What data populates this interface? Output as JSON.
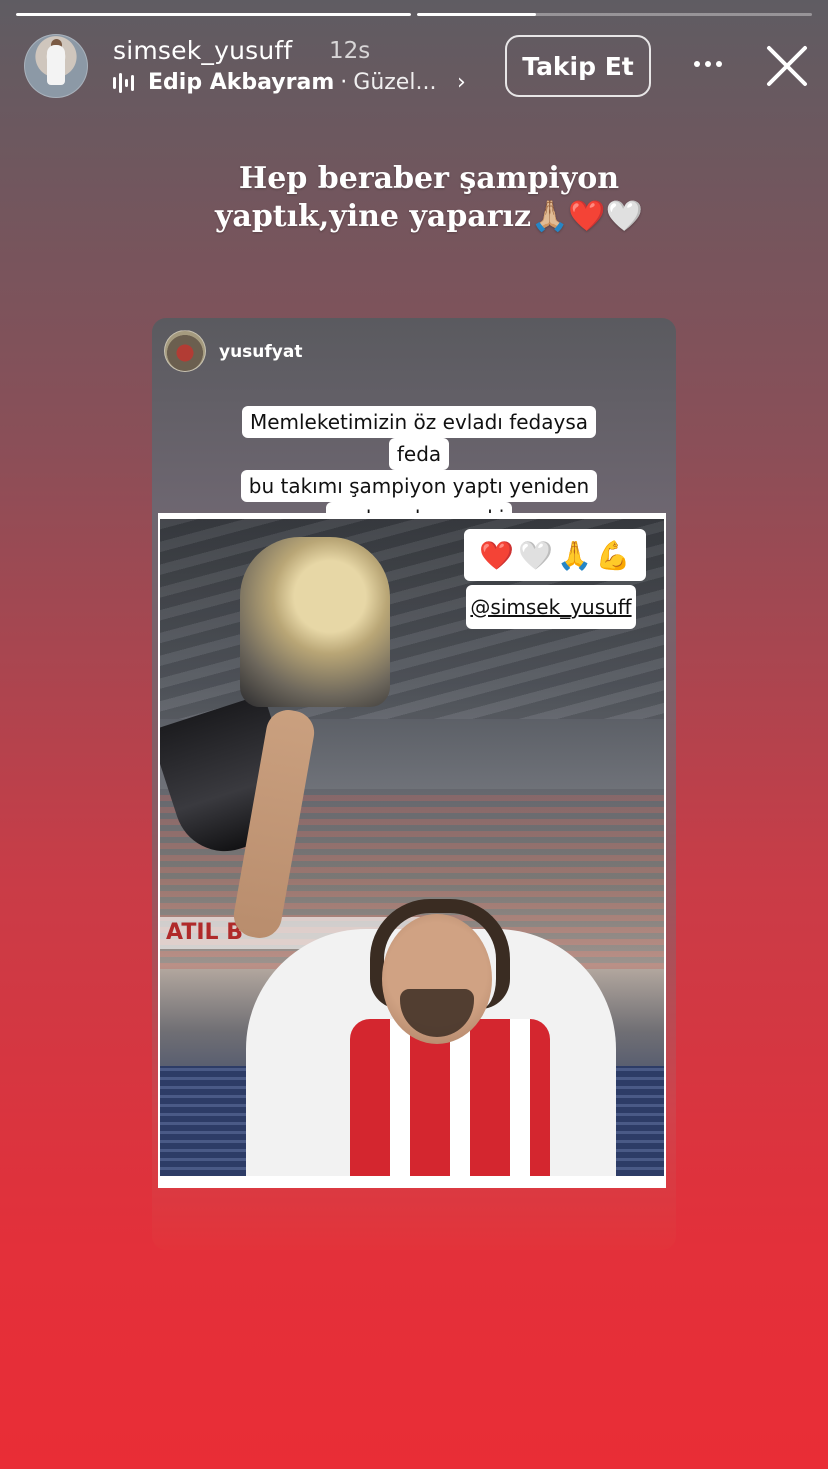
{
  "story": {
    "progress": [
      1.0,
      0.3
    ]
  },
  "header": {
    "username": "simsek_yusuff",
    "time": "12s",
    "music": {
      "artist": "Edip Akbayram",
      "separator": "·",
      "song": "Güzel..."
    },
    "follow_label": "Takip Et"
  },
  "caption": "Hep beraber şampiyon yaptık,yine yaparız🙏🏼❤️🤍",
  "reshared_post": {
    "username": "yusufyat",
    "quote": [
      "Memleketimizin öz evladı fedaysa feda",
      "bu takımı şampiyon yaptı yeniden",
      "neden olmasın ki"
    ],
    "emoji_sticker": [
      "❤️",
      "🤍",
      "🙏",
      "💪"
    ],
    "mention": "@simsek_yusuff",
    "banner_text": "ATIL B"
  },
  "icons": {
    "music": "music-bars-icon",
    "chevron": "chevron-right-icon",
    "more": "more-horizontal-icon",
    "close": "close-icon"
  }
}
